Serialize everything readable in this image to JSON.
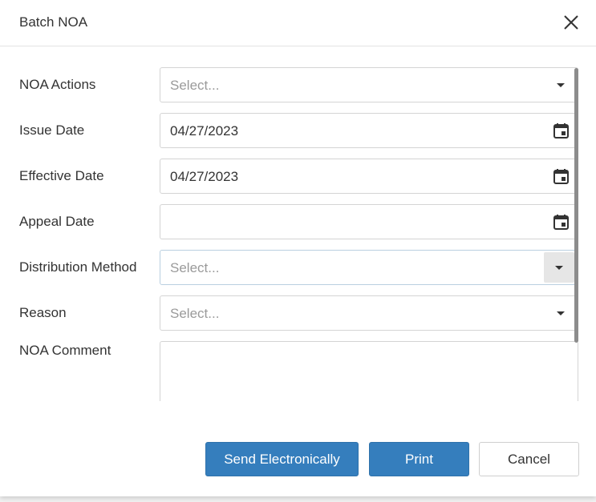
{
  "dialog": {
    "title": "Batch NOA"
  },
  "icons": {
    "close": "close-icon",
    "calendar": "calendar-icon",
    "dropdown": "chevron-down-icon"
  },
  "form": {
    "noa_actions": {
      "label": "NOA Actions",
      "placeholder": "Select..."
    },
    "issue_date": {
      "label": "Issue Date",
      "value": "04/27/2023"
    },
    "effective_date": {
      "label": "Effective Date",
      "value": "04/27/2023"
    },
    "appeal_date": {
      "label": "Appeal Date",
      "value": ""
    },
    "distribution_method": {
      "label": "Distribution Method",
      "placeholder": "Select..."
    },
    "reason": {
      "label": "Reason",
      "placeholder": "Select..."
    },
    "noa_comment": {
      "label": "NOA Comment",
      "value": ""
    }
  },
  "buttons": {
    "send_electronically": "Send Electronically",
    "print": "Print",
    "cancel": "Cancel"
  },
  "colors": {
    "primary": "#357ebd",
    "border": "#d4d4d4",
    "placeholder": "#9a9a9a",
    "text": "#333333"
  }
}
